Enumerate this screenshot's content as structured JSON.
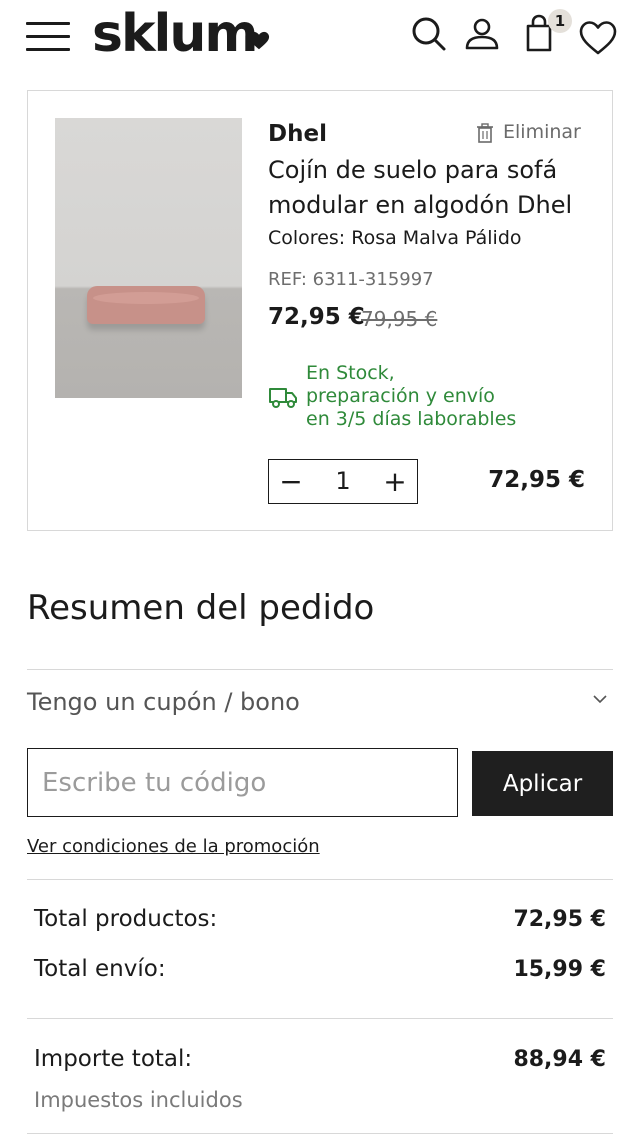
{
  "header": {
    "logo_text": "sklum",
    "cart_count": "1",
    "icons": [
      "menu-icon",
      "search-icon",
      "user-icon",
      "cart-bag-icon",
      "heart-icon"
    ]
  },
  "cart_item": {
    "brand": "Dhel",
    "remove_label": "Eliminar",
    "name": "Cojín de suelo para sofá modular en algodón Dhel",
    "colors": "Colores: Rosa Malva Pálido",
    "ref": "REF: 6311-315997",
    "price": "72,95 €",
    "old_price": "79,95 €",
    "stock_lines": [
      "En Stock,",
      "preparación y envío",
      "en 3/5 días laborables"
    ],
    "quantity": "1",
    "line_total": "72,95 €",
    "stock_color": "#2f8a3a"
  },
  "summary": {
    "title": "Resumen del pedido",
    "coupon_toggle": "Tengo un cupón / bono",
    "coupon_placeholder": "Escribe tu código",
    "apply_label": "Aplicar",
    "promo_link": "Ver condiciones de la promoción",
    "total_products_label": "Total productos:",
    "total_products_value": "72,95 €",
    "shipping_label": "Total envío:",
    "shipping_value": "15,99 €",
    "grand_total_label": "Importe total:",
    "grand_total_value": "88,94 €",
    "taxes_note": "Impuestos incluidos"
  }
}
